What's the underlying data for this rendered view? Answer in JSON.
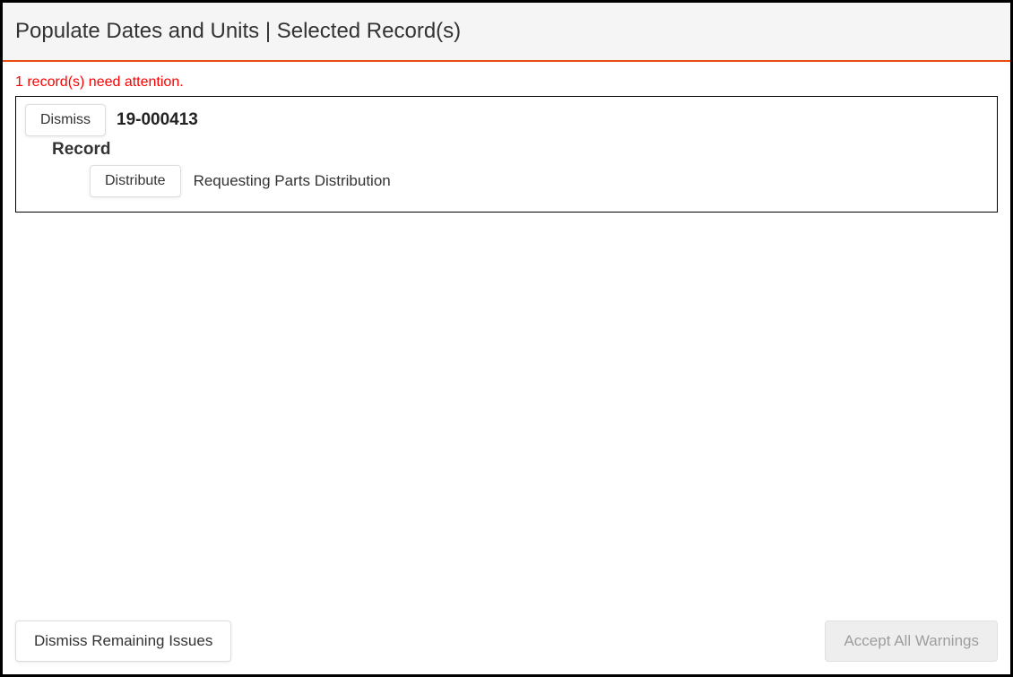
{
  "header": {
    "title": "Populate Dates and Units | Selected Record(s)"
  },
  "attention_message": "1 record(s) need attention.",
  "record": {
    "dismiss_label": "Dismiss",
    "id": "19-000413",
    "label": "Record",
    "action_label": "Distribute",
    "action_description": "Requesting Parts Distribution"
  },
  "footer": {
    "dismiss_remaining_label": "Dismiss Remaining Issues",
    "accept_all_label": "Accept All Warnings"
  }
}
